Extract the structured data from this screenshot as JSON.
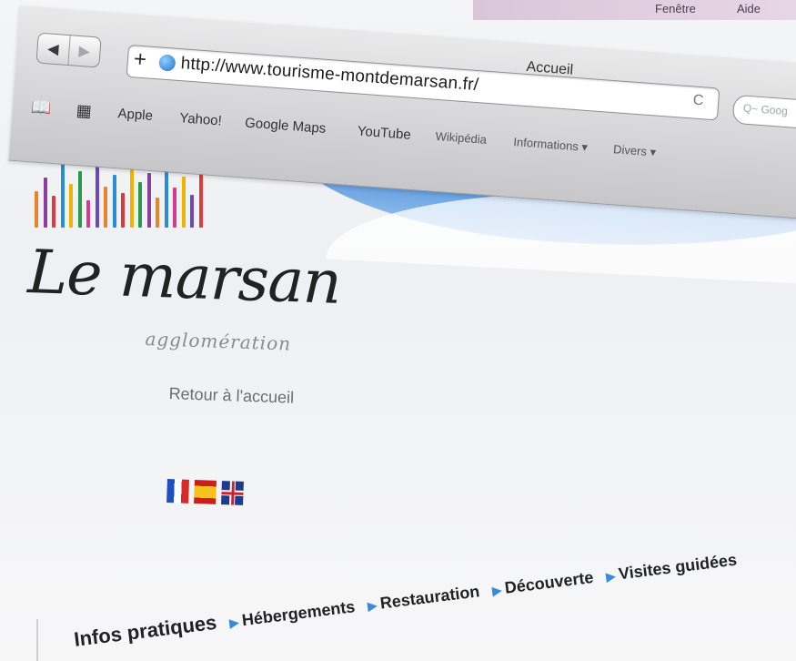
{
  "browser": {
    "menubar_left": "Fenêtre",
    "menubar_right": "Aide",
    "window_title": "Accueil",
    "back_glyph": "◀",
    "forward_glyph": "▶",
    "add_glyph": "+",
    "url": "http://www.tourisme-montdemarsan.fr/",
    "reload_glyph": "C",
    "search_placeholder": "Q~ Goog"
  },
  "bookmarks": {
    "items": [
      "Apple",
      "Yahoo!",
      "Google Maps",
      "YouTube",
      "Wikipédia",
      "Informations ▾",
      "Divers ▾"
    ]
  },
  "site": {
    "logo_title": "Le marsan",
    "logo_subtitle": "agglomération",
    "home_link": "Retour à l'accueil",
    "bar_colors": [
      "#e8832a",
      "#8a3fa0",
      "#e03a3a",
      "#2a8bd8",
      "#f0b400",
      "#2a9a4a",
      "#d63a8a",
      "#6a4ab8",
      "#e8832a",
      "#2a8bd8",
      "#d63a3a",
      "#f0b400",
      "#2a9a4a",
      "#8a3fa0",
      "#e8832a",
      "#2a8bd8",
      "#d63a8a",
      "#f0b400",
      "#6a4ab8",
      "#e03a3a"
    ]
  },
  "nav": {
    "items": [
      "Infos pratiques",
      "Hébergements",
      "Restauration",
      "Découverte",
      "Visites guidées"
    ]
  },
  "colors": {
    "accent": "#3b7ed1",
    "nav_arrow": "#3a8ad8"
  }
}
